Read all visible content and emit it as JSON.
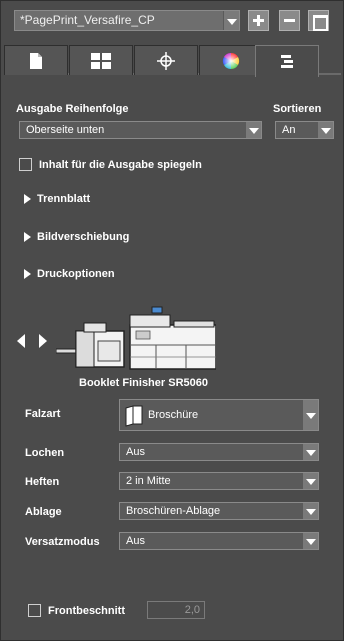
{
  "preset": {
    "value": "*PagePrint_Versafire_CP"
  },
  "toolbar": {
    "add_icon": "plus-icon",
    "remove_icon": "minus-icon",
    "window_icon": "window-icon"
  },
  "tabs": [
    {
      "icon": "document-icon"
    },
    {
      "icon": "layout-grid-icon"
    },
    {
      "icon": "crosshair-icon"
    },
    {
      "icon": "color-wheel-icon"
    },
    {
      "icon": "finishing-icon",
      "active": true
    }
  ],
  "output": {
    "order_label": "Ausgabe Reihenfolge",
    "order_value": "Oberseite unten",
    "sort_label": "Sortieren",
    "sort_value": "An",
    "mirror_label": "Inhalt für die Ausgabe spiegeln"
  },
  "sections": {
    "separator_sheet": "Trennblatt",
    "image_shift": "Bildverschiebung",
    "print_options": "Druckoptionen"
  },
  "finisher": {
    "name": "Booklet Finisher SR5060"
  },
  "settings": {
    "fold_label": "Falzart",
    "fold_value": "Broschüre",
    "punch_label": "Lochen",
    "punch_value": "Aus",
    "staple_label": "Heften",
    "staple_value": "2 in Mitte",
    "tray_label": "Ablage",
    "tray_value": "Broschüren-Ablage",
    "offset_label": "Versatzmodus",
    "offset_value": "Aus"
  },
  "trim": {
    "label": "Frontbeschnitt",
    "value": "2,0"
  }
}
